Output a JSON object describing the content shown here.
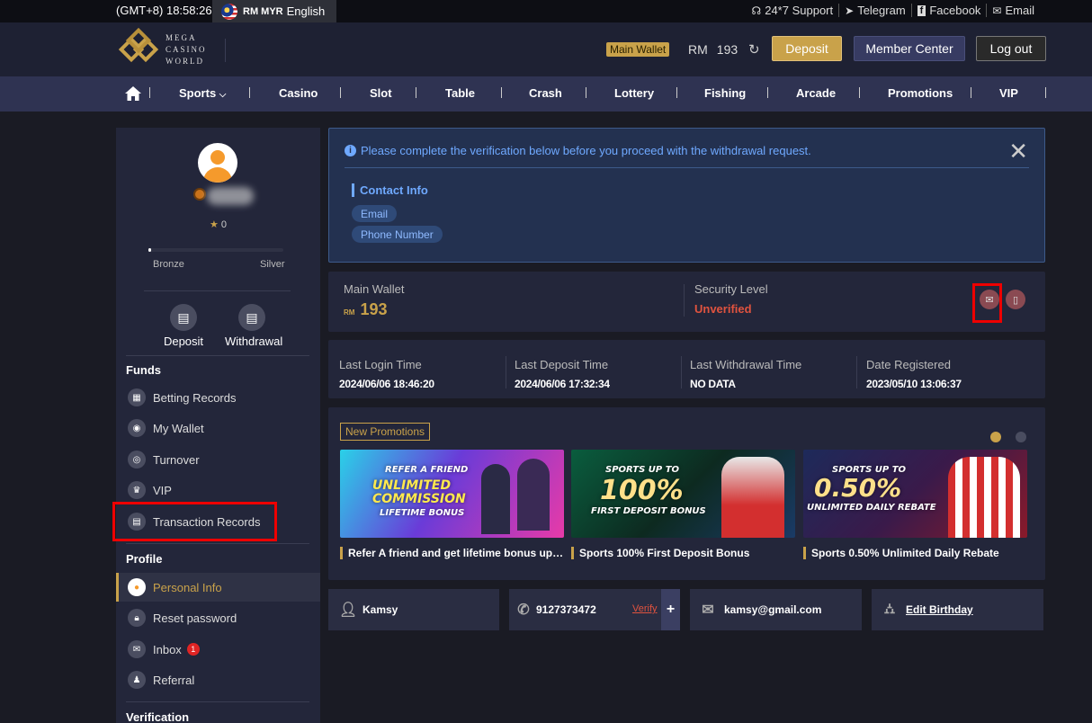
{
  "topbar": {
    "clock": "(GMT+8) 18:58:26",
    "currency": "RM MYR",
    "language": "English",
    "links": [
      {
        "icon": "headset-icon",
        "label": "24*7 Support"
      },
      {
        "icon": "telegram-icon",
        "label": "Telegram"
      },
      {
        "icon": "facebook-icon",
        "label": "Facebook"
      },
      {
        "icon": "email-icon",
        "label": "Email"
      }
    ]
  },
  "header": {
    "logo_lines": [
      "MEGA",
      "CASINO",
      "WORLD"
    ],
    "wallet_tag": "Main Wallet",
    "wallet_currency": "RM",
    "wallet_amount": "193",
    "deposit_label": "Deposit",
    "member_label": "Member Center",
    "logout_label": "Log out"
  },
  "nav": {
    "items": [
      "Sports",
      "Casino",
      "Slot",
      "Table",
      "Crash",
      "Lottery",
      "Fishing",
      "Arcade",
      "Promotions",
      "VIP"
    ]
  },
  "sidebar": {
    "stars": "0",
    "level_progress": 0.02,
    "level_from": "Bronze",
    "level_to": "Silver",
    "deposit_label": "Deposit",
    "withdrawal_label": "Withdrawal",
    "funds_title": "Funds",
    "funds_items": [
      "Betting Records",
      "My Wallet",
      "Turnover",
      "VIP",
      "Transaction Records"
    ],
    "profile_title": "Profile",
    "profile_items": [
      "Personal Info",
      "Reset password",
      "Inbox",
      "Referral"
    ],
    "inbox_count": "1",
    "verification_title": "Verification"
  },
  "notice": {
    "message": "Please complete the verification below before you proceed with the withdrawal request.",
    "contact_title": "Contact Info",
    "pills": [
      "Email",
      "Phone Number"
    ]
  },
  "wallet_panel": {
    "main_label": "Main Wallet",
    "currency": "RM",
    "amount": "193",
    "security_label": "Security Level",
    "security_value": "Unverified"
  },
  "stats": [
    {
      "label": "Last Login Time",
      "value": "2024/06/06 18:46:20"
    },
    {
      "label": "Last Deposit Time",
      "value": "2024/06/06 17:32:34"
    },
    {
      "label": "Last Withdrawal Time",
      "value": "NO DATA"
    },
    {
      "label": "Date Registered",
      "value": "2023/05/10 13:06:37"
    }
  ],
  "promotions": {
    "tag": "New Promotions",
    "banners": [
      {
        "text1": "REFER A FRIEND",
        "text2": "UNLIMITED COMMISSION",
        "text3": "LIFETIME BONUS",
        "caption": "Refer A friend and get lifetime bonus up to ..."
      },
      {
        "text1": "SPORTS UP TO",
        "text2": "100%",
        "text3": "FIRST DEPOSIT BONUS",
        "caption": "Sports 100% First Deposit Bonus"
      },
      {
        "text1": "SPORTS UP TO",
        "text2": "0.50%",
        "text3": "UNLIMITED DAILY REBATE",
        "caption": "Sports 0.50% Unlimited Daily Rebate"
      }
    ]
  },
  "profile_info": {
    "name": "Kamsy",
    "phone": "9127373472",
    "verify_label": "Verify",
    "plus": "+",
    "email": "kamsy@gmail.com",
    "birthday_label": "Edit Birthday"
  },
  "colors": {
    "accent": "#c9a24a",
    "danger": "#e0533f",
    "info": "#6fa9ff"
  }
}
